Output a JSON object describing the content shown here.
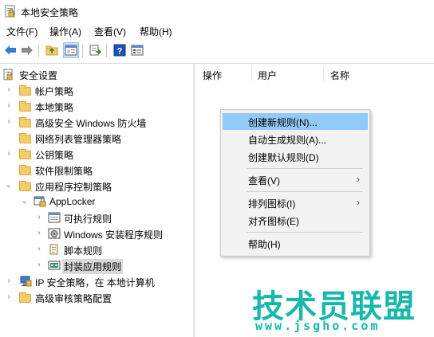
{
  "window": {
    "title": "本地安全策略"
  },
  "menu": [
    "文件(F)",
    "操作(A)",
    "查看(V)",
    "帮助(H)"
  ],
  "toolbar": {
    "buttons": [
      "back-arrow-icon",
      "forward-arrow-icon",
      "up-folder-icon",
      "show-hide-tree-icon",
      "export-list-icon",
      "help-icon",
      "properties-icon"
    ]
  },
  "tree": {
    "items": [
      {
        "label": "安全设置"
      },
      {
        "label": "帐户策略"
      },
      {
        "label": "本地策略"
      },
      {
        "label": "高级安全 Windows 防火墙"
      },
      {
        "label": "网络列表管理器策略"
      },
      {
        "label": "公钥策略"
      },
      {
        "label": "软件限制策略"
      },
      {
        "label": "应用程序控制策略"
      },
      {
        "label": "AppLocker"
      },
      {
        "label": "可执行规则"
      },
      {
        "label": "Windows 安装程序规则"
      },
      {
        "label": "脚本规则"
      },
      {
        "label": "封装应用规则"
      },
      {
        "label": "IP 安全策略，在 本地计算机"
      },
      {
        "label": "高级审核策略配置"
      }
    ]
  },
  "list": {
    "columns": [
      "操作",
      "用户",
      "名称"
    ]
  },
  "context_menu": {
    "items": [
      "创建新规则(N)...",
      "自动生成规则(A)...",
      "创建默认规则(D)",
      "查看(V)",
      "排列图标(I)",
      "对齐图标(E)",
      "帮助(H)"
    ],
    "highlighted": "创建新规则(N)..."
  },
  "watermark": {
    "main": "技术员联盟",
    "sub": "www.jsgho.com"
  },
  "colors": {
    "highlight": "#91c9f7",
    "watermark": "#16b8ac",
    "folder": "#f3cd6b"
  }
}
